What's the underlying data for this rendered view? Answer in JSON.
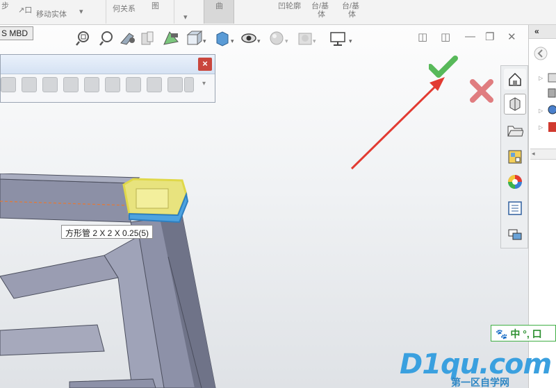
{
  "ribbon": {
    "items": [
      {
        "label": "步"
      },
      {
        "label": "↗口"
      },
      {
        "label": "移动实体"
      },
      {
        "label": "何关系"
      },
      {
        "label": "图"
      },
      {
        "label": "▾"
      },
      {
        "label": "曲"
      },
      {
        "label": "凹轮廓"
      },
      {
        "label": "台/基"
      },
      {
        "label": "体"
      },
      {
        "label": "台/基"
      },
      {
        "label": "体"
      }
    ]
  },
  "tabs": {
    "mbd_label": "S MBD"
  },
  "float_toolbar": {
    "close_label": "×",
    "dropdown_label": "▾"
  },
  "tooltip": {
    "text": "方形管 2 X 2 X 0.25(5)"
  },
  "confirm": {
    "ok_label": "✔",
    "cancel_label": "✖"
  },
  "window_controls": {
    "min": "—",
    "restore": "❐",
    "close": "✕",
    "pane1": "◫",
    "pane2": "◫"
  },
  "right_panel": {
    "collapse_label": "«"
  },
  "ime": {
    "text": "中 °, 口"
  },
  "watermark": {
    "main": "D1qu.com",
    "sub": "第一区自学网"
  },
  "icons": {
    "view": [
      "zoom-to-fit-icon",
      "zoom-area-icon",
      "previous-view-icon",
      "section-view-icon",
      "dynamic-annotation-icon",
      "view-orientation-icon",
      "display-style-icon",
      "hide-show-icon",
      "edit-appearance-icon",
      "apply-scene-icon",
      "view-settings-icon"
    ],
    "side": [
      "home-icon",
      "part-icon",
      "folder-icon",
      "design-library-icon",
      "appearances-icon",
      "custom-properties-icon",
      "forum-icon"
    ]
  },
  "colors": {
    "accent_green": "#58b95a",
    "cancel_red": "#e07d80",
    "arrow_red": "#e23b32",
    "frame_steel": "#8a8ea3",
    "highlight_yellow": "#e8e27a"
  }
}
